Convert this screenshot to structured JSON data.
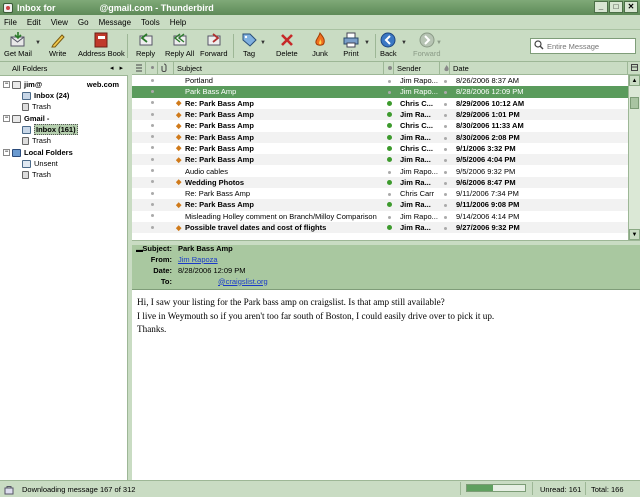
{
  "window": {
    "title_left": "Inbox for",
    "title_right": "@gmail.com - Thunderbird",
    "min_label": "_",
    "max_label": "□",
    "close_label": "✕"
  },
  "menu": [
    "File",
    "Edit",
    "View",
    "Go",
    "Message",
    "Tools",
    "Help"
  ],
  "toolbar": {
    "get_mail": "Get Mail",
    "write": "Write",
    "address_book": "Address Book",
    "reply": "Reply",
    "reply_all": "Reply All",
    "forward": "Forward",
    "tag": "Tag",
    "delete": "Delete",
    "junk": "Junk",
    "print": "Print",
    "back": "Back",
    "forward_nav": "Forward"
  },
  "search": {
    "placeholder": "Entire Message"
  },
  "folders": {
    "header": "All Folders",
    "nav": "◂ ▸",
    "items": [
      {
        "label": "jim@",
        "suffix": "web.com",
        "twist": "−"
      },
      {
        "label": "Inbox (24)"
      },
      {
        "label": "Trash"
      },
      {
        "label": "Gmail -",
        "twist": "−"
      },
      {
        "label": "Inbox (161)"
      },
      {
        "label": "Trash"
      },
      {
        "label": "Local Folders",
        "twist": "−"
      },
      {
        "label": "Unsent"
      },
      {
        "label": "Trash"
      }
    ]
  },
  "list": {
    "columns": {
      "subject": "Subject",
      "sender": "Sender",
      "date": "Date"
    },
    "rows": [
      {
        "subject": "Portland",
        "sender": "Jim Rapo...",
        "date": "8/26/2006 8:37 AM",
        "unread": false,
        "selected": false,
        "thread": false
      },
      {
        "subject": "Park Bass Amp",
        "sender": "Jim Rapo...",
        "date": "8/28/2006 12:09 PM",
        "unread": false,
        "selected": true,
        "thread": false
      },
      {
        "subject": "Re: Park Bass Amp",
        "sender": "Chris C...",
        "date": "8/29/2006 10:12 AM",
        "unread": true,
        "selected": false,
        "thread": true
      },
      {
        "subject": "Re: Park Bass Amp",
        "sender": "Jim Ra...",
        "date": "8/29/2006 1:01 PM",
        "unread": true,
        "selected": false,
        "thread": true
      },
      {
        "subject": "Re: Park Bass Amp",
        "sender": "Chris C...",
        "date": "8/30/2006 11:33 AM",
        "unread": true,
        "selected": false,
        "thread": true
      },
      {
        "subject": "Re: Park Bass Amp",
        "sender": "Jim Ra...",
        "date": "8/30/2006 2:08 PM",
        "unread": true,
        "selected": false,
        "thread": true
      },
      {
        "subject": "Re: Park Bass Amp",
        "sender": "Chris C...",
        "date": "9/1/2006 3:32 PM",
        "unread": true,
        "selected": false,
        "thread": true
      },
      {
        "subject": "Re: Park Bass Amp",
        "sender": "Jim Ra...",
        "date": "9/5/2006 4:04 PM",
        "unread": true,
        "selected": false,
        "thread": true
      },
      {
        "subject": "Audio cables",
        "sender": "Jim Rapo...",
        "date": "9/5/2006 9:32 PM",
        "unread": false,
        "selected": false,
        "thread": false
      },
      {
        "subject": "Wedding Photos",
        "sender": "Jim Ra...",
        "date": "9/6/2006 8:47 PM",
        "unread": true,
        "selected": false,
        "thread": true
      },
      {
        "subject": "Re: Park Bass Amp",
        "sender": "Chris Carr",
        "date": "9/11/2006 7:34 PM",
        "unread": false,
        "selected": false,
        "thread": false
      },
      {
        "subject": "Re: Park Bass Amp",
        "sender": "Jim Ra...",
        "date": "9/11/2006 9:08 PM",
        "unread": true,
        "selected": false,
        "thread": true
      },
      {
        "subject": "Misleading Holley comment on Branch/Milloy Comparison",
        "sender": "Jim Rapo...",
        "date": "9/14/2006 4:14 PM",
        "unread": false,
        "selected": false,
        "thread": false
      },
      {
        "subject": "Possible travel dates and cost of flights",
        "sender": "Jim Ra...",
        "date": "9/27/2006 9:32 PM",
        "unread": true,
        "selected": false,
        "thread": true
      }
    ]
  },
  "header": {
    "subject_label": "Subject:",
    "subject": "Park Bass Amp",
    "from_label": "From:",
    "from": "Jim Rapoza",
    "date_label": "Date:",
    "date": "8/28/2006 12:09 PM",
    "to_label": "To:",
    "to": "@craigslist.org"
  },
  "body": {
    "lines": [
      "Hi, I saw your listing for the Park bass amp on craigslist. Is that amp still available?",
      "I live in Weymouth so if you aren't too far south of Boston, I could easily drive over to pick it up.",
      "Thanks."
    ]
  },
  "status": {
    "message": "Downloading message 167 of 312",
    "progress": 0.44,
    "unread": "Unread: 161",
    "total": "Total: 166"
  },
  "colors": {
    "chrome": "#c9dcc3",
    "selection": "#5a9b5c",
    "header_pane": "#a9c8a0",
    "thread_dot": "#d07a1a",
    "read_dot": "#3d9a2d"
  }
}
